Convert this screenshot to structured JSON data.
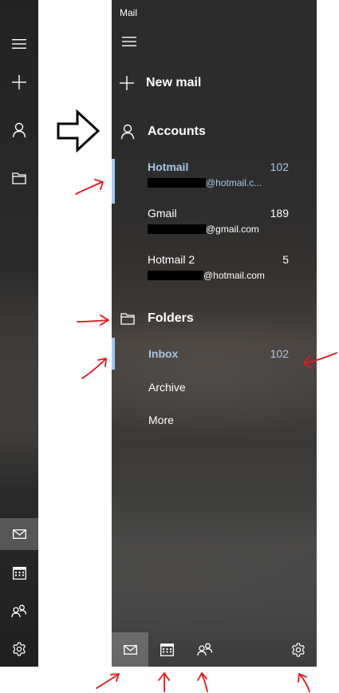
{
  "app": {
    "title": "Mail"
  },
  "icons": {
    "menu": "hamburger-icon",
    "new": "plus-icon",
    "account": "person-icon",
    "folder": "folder-icon",
    "mail": "mail-icon",
    "calendar": "calendar-icon",
    "people": "people-icon",
    "settings": "gear-icon"
  },
  "colors": {
    "accent": "#a9c7e8",
    "text": "#ffffff",
    "annotation": "#e0191f"
  },
  "nav": {
    "new_mail_label": "New mail",
    "accounts_label": "Accounts",
    "folders_label": "Folders"
  },
  "accounts": [
    {
      "name": "Hotmail",
      "count": "102",
      "email_domain": "@hotmail.c...",
      "selected": true
    },
    {
      "name": "Gmail",
      "count": "189",
      "email_domain": "@gmail.com",
      "selected": false
    },
    {
      "name": "Hotmail 2",
      "count": "5",
      "email_domain": "@hotmail.com",
      "selected": false
    }
  ],
  "folders": [
    {
      "name": "Inbox",
      "count": "102",
      "selected": true
    },
    {
      "name": "Archive",
      "count": "",
      "selected": false
    },
    {
      "name": "More",
      "count": "",
      "selected": false
    }
  ]
}
